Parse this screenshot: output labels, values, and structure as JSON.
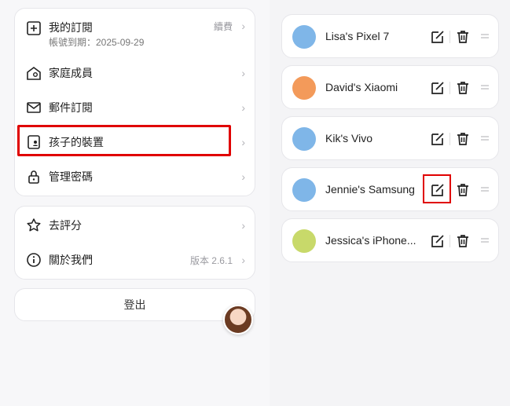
{
  "account": {
    "subscription": {
      "label": "我的訂閱",
      "expiry": "帳號到期：2025-09-29",
      "action": "續費"
    },
    "family": {
      "label": "家庭成員"
    },
    "email": {
      "label": "郵件訂閱"
    },
    "devices": {
      "label": "孩子的裝置"
    },
    "password": {
      "label": "管理密碼"
    },
    "rate": {
      "label": "去評分"
    },
    "about": {
      "label": "關於我們",
      "version": "版本 2.6.1"
    },
    "logout_label": "登出"
  },
  "devices": [
    {
      "name": "Lisa's Pixel 7",
      "avatar": "blue-monster",
      "color": "#7fb6e8"
    },
    {
      "name": "David's Xiaomi",
      "avatar": "carrot",
      "color": "#f39a5a"
    },
    {
      "name": "Kik's Vivo",
      "avatar": "blue-monster",
      "color": "#7fb6e8"
    },
    {
      "name": "Jennie's Samsung",
      "avatar": "blue-monster",
      "color": "#7fb6e8"
    },
    {
      "name": "Jessica's iPhone...",
      "avatar": "pear",
      "color": "#c8d96a"
    }
  ]
}
